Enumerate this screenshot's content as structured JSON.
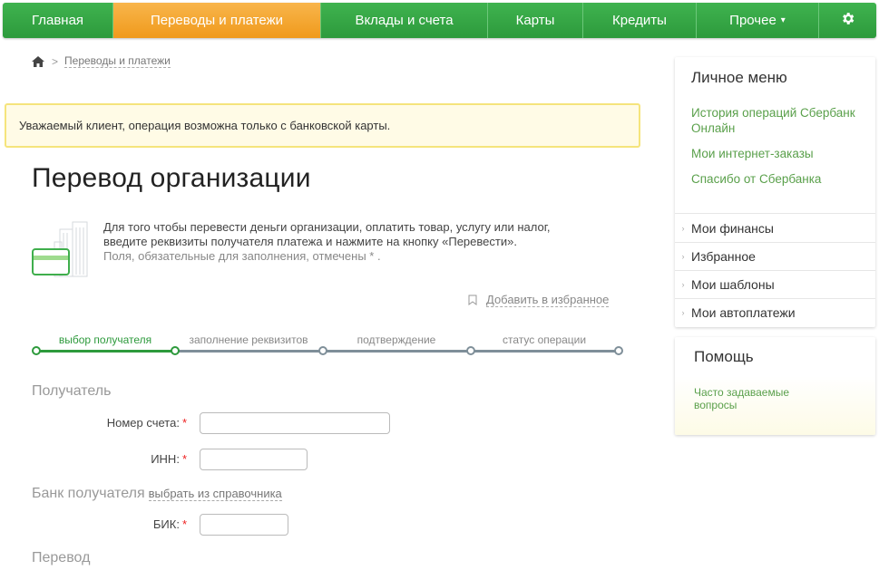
{
  "nav": {
    "items": [
      {
        "label": "Главная"
      },
      {
        "label": "Переводы и платежи"
      },
      {
        "label": "Вклады и счета"
      },
      {
        "label": "Карты"
      },
      {
        "label": "Кредиты"
      },
      {
        "label": "Прочее"
      }
    ],
    "more_caret": "▾",
    "settings_icon": "gear-icon",
    "active_color": "#f4a62a",
    "primary_color": "#35a646"
  },
  "breadcrumb": {
    "home_icon": "home-icon",
    "separator": ">",
    "current": "Переводы и платежи"
  },
  "alert": {
    "text": "Уважаемый клиент, операция возможна только с банковской карты."
  },
  "page_title": "Перевод организации",
  "info": {
    "line1": "Для того чтобы перевести деньги организации, оплатить товар, услугу или налог,",
    "line2": "введите реквизиты получателя платежа и нажмите на кнопку «Перевести».",
    "line3": "Поля, обязательные для заполнения, отмечены * ."
  },
  "favorite": {
    "label": "Добавить в избранное"
  },
  "steps": [
    {
      "label": "выбор получателя",
      "active": true
    },
    {
      "label": "заполнение реквизитов",
      "active": false
    },
    {
      "label": "подтверждение",
      "active": false
    },
    {
      "label": "статус операции",
      "active": false
    }
  ],
  "form": {
    "recipient_section": "Получатель",
    "account_label": "Номер счета:",
    "inn_label": "ИНН:",
    "bank_section": "Банк получателя",
    "bank_dict_link": "выбрать из справочника",
    "bik_label": "БИК:",
    "transfer_section": "Перевод",
    "required_mark": "*",
    "account_value": "",
    "inn_value": "",
    "bik_value": ""
  },
  "sidebar": {
    "title": "Личное меню",
    "links": [
      "История операций Сбербанк Онлайн",
      "Мои интернет-заказы",
      "Спасибо от Сбербанка"
    ],
    "sections": [
      "Мои финансы",
      "Избранное",
      "Мои шаблоны",
      "Мои автоплатежи"
    ]
  },
  "help": {
    "title": "Помощь",
    "faq": "Часто задаваемые вопросы"
  }
}
